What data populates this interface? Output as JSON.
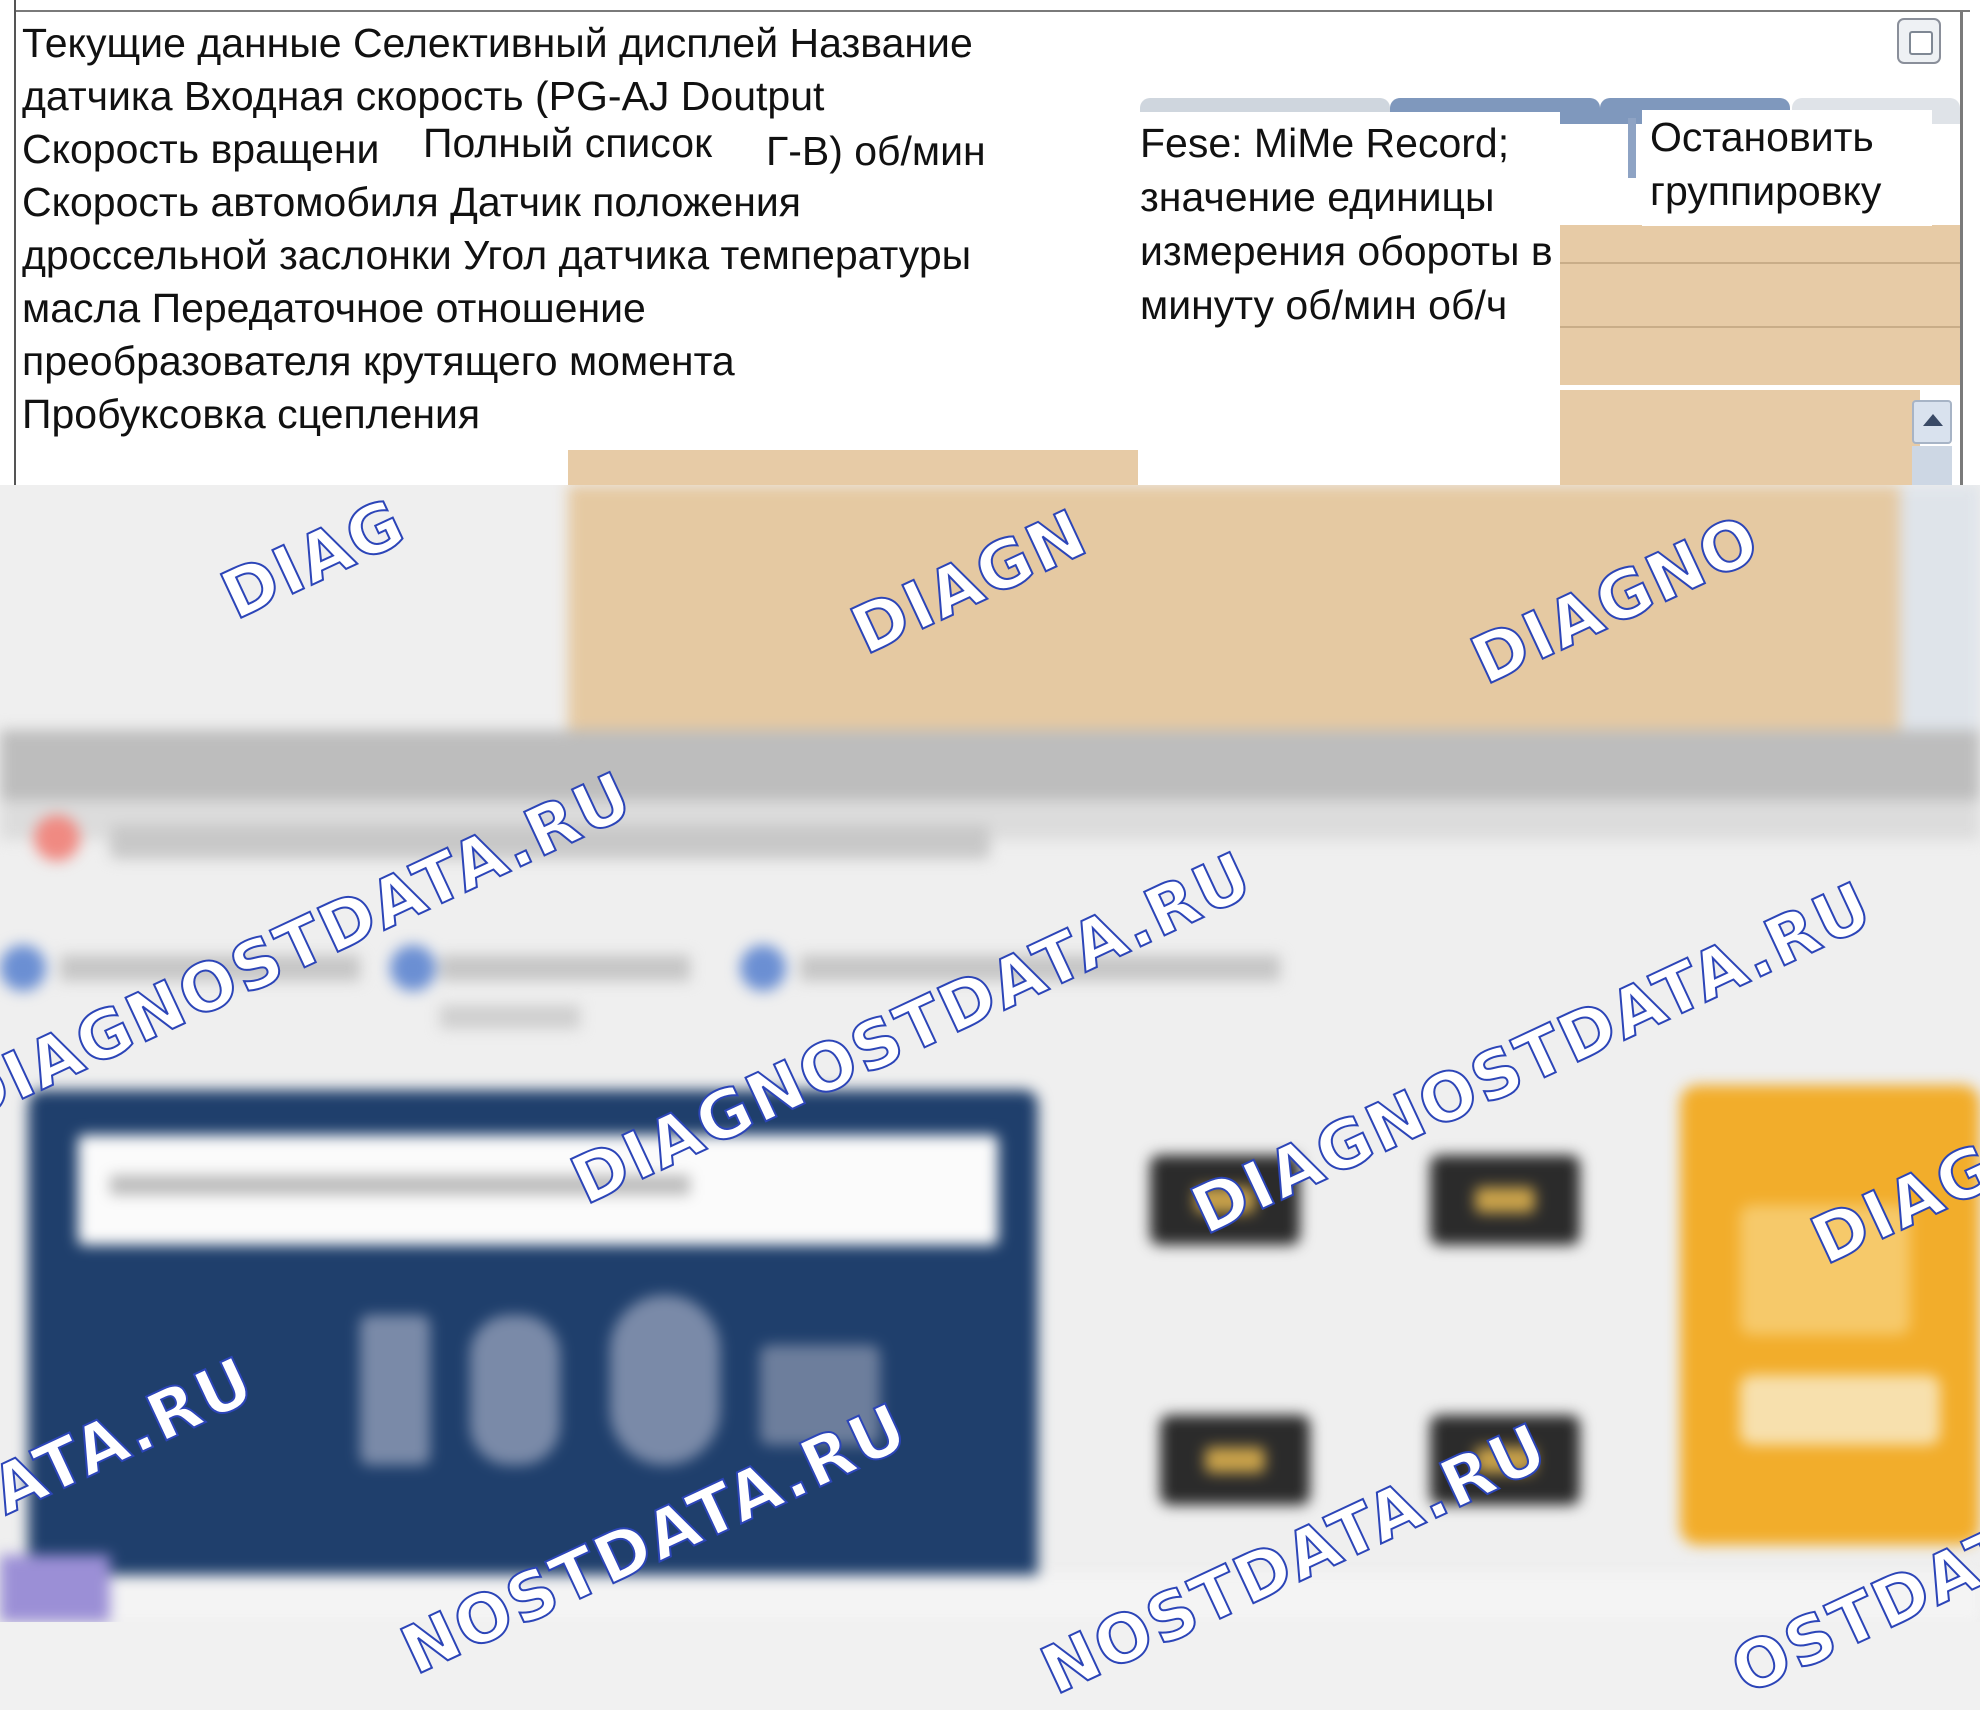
{
  "dialog": {
    "main_lines": [
      "Текущие данные Селективный дисплей Название",
      "датчика Входная скорость (PG-AJ Doutput",
      "Скорость вращени",
      "Скорость автомобиля Датчик положения",
      "дроссельной заслонки Угол датчика температуры",
      "масла Передаточное отношение",
      "преобразователя крутящего момента",
      "Пробуксовка сцепления"
    ],
    "full_list_label": "Полный список",
    "range_unit": "Г-В) об/мин",
    "middle_lines": [
      "Fese: MiMe Record;",
      "значение единицы",
      "измерения обороты в",
      "минуту об/мин об/ч"
    ],
    "stop_grouping_lines": [
      "Остановить",
      "группировку"
    ]
  },
  "watermark": {
    "text": "DIAGNOSTDATA.RU",
    "fragments": [
      "DIAG",
      "DIAGN",
      "DIAGNO",
      "DIAGNOSTDATA.RU",
      "DIAGNOSTDATA.RU",
      "DIAGNOSTDATA.RU",
      "DIAGN",
      "DIAGNOSTDATA.RU",
      "DIA",
      "ATA.RU",
      "NOSTDATA.RU",
      "NOSTDATA.RU",
      "OSTDATA",
      "AGNOSTDATA.RU"
    ],
    "stroke_color": "#2c45b8"
  },
  "colors": {
    "tan": "#e7cba6",
    "panel_navy": "#1f3f6c",
    "accent_yellow": "#f2ad2b"
  }
}
